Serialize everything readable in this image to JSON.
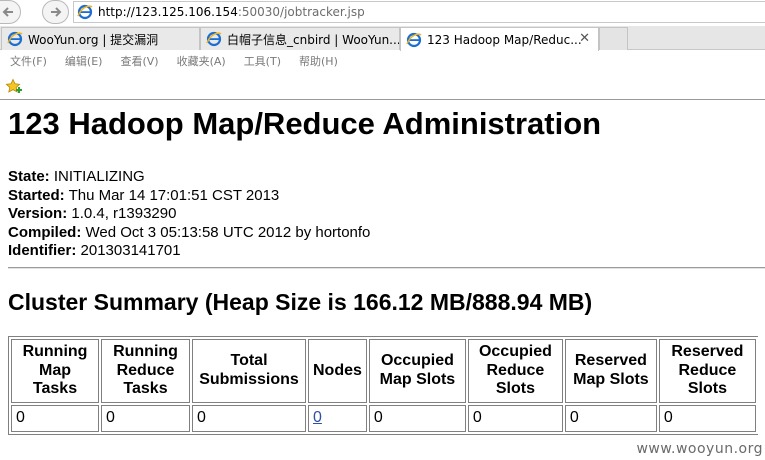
{
  "browser": {
    "url_host": "http://123.125.106.154",
    "url_rest": ":50030/jobtracker.jsp",
    "tabs": [
      {
        "label": "WooYun.org | 提交漏洞"
      },
      {
        "label": "白帽子信息_cnbird | WooYun..."
      },
      {
        "label": "123 Hadoop Map/Reduc...",
        "close": "✕"
      }
    ],
    "menu": [
      "文件(F)",
      "编辑(E)",
      "查看(V)",
      "收藏夹(A)",
      "工具(T)",
      "帮助(H)"
    ],
    "icons": {
      "back": "back-arrow-icon",
      "forward": "forward-arrow-icon",
      "page": "ie-page-icon",
      "favorites": "favorites-star-icon"
    },
    "accent_color": "#1c6fd1"
  },
  "page": {
    "title": "123 Hadoop Map/Reduce Administration",
    "info": [
      {
        "label": "State:",
        "value": " INITIALIZING"
      },
      {
        "label": "Started:",
        "value": " Thu Mar 14 17:01:51 CST 2013"
      },
      {
        "label": "Version:",
        "value": " 1.0.4, r1393290"
      },
      {
        "label": "Compiled:",
        "value": " Wed Oct 3 05:13:58 UTC 2012 by hortonfo"
      },
      {
        "label": "Identifier:",
        "value": " 201303141701"
      }
    ],
    "cluster_summary_title": "Cluster Summary (Heap Size is 166.12 MB/888.94 MB)",
    "table": {
      "headers": [
        "Running Map Tasks",
        "Running Reduce Tasks",
        "Total Submissions",
        "Nodes",
        "Occupied Map Slots",
        "Occupied Reduce Slots",
        "Reserved Map Slots",
        "Reserved Reduce Slots"
      ],
      "row": [
        "0",
        "0",
        "0",
        "0",
        "0",
        "0",
        "0",
        "0"
      ]
    }
  },
  "watermark": "www.wooyun.org"
}
